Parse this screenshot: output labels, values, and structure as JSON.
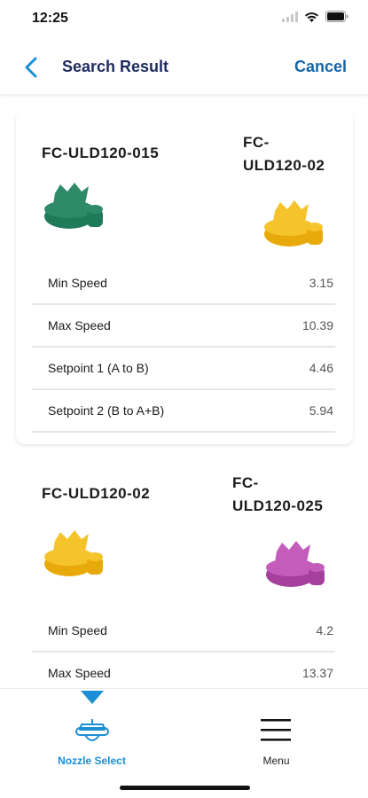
{
  "status_bar": {
    "time": "12:25"
  },
  "nav": {
    "title": "Search Result",
    "cancel_label": "Cancel"
  },
  "cards": [
    {
      "left_nozzle": {
        "name": "FC-ULD120-015",
        "color": "#1f7a5a"
      },
      "right_nozzle": {
        "name_line1": "FC-",
        "name_line2": "ULD120-02",
        "color": "#f2b511"
      },
      "specs": [
        {
          "label": "Min Speed",
          "value": "3.15"
        },
        {
          "label": "Max Speed",
          "value": "10.39"
        },
        {
          "label": "Setpoint 1 (A to B)",
          "value": "4.46"
        },
        {
          "label": "Setpoint 2 (B to A+B)",
          "value": "5.94"
        }
      ]
    },
    {
      "left_nozzle": {
        "name": "FC-ULD120-02",
        "color": "#f2b511"
      },
      "right_nozzle": {
        "name_line1": "FC-",
        "name_line2": "ULD120-025",
        "color": "#b04aa8"
      },
      "specs": [
        {
          "label": "Min Speed",
          "value": "4.2"
        },
        {
          "label": "Max Speed",
          "value": "13.37"
        }
      ]
    }
  ],
  "tabs": [
    {
      "label": "Nozzle Select",
      "icon": "nozzle-icon",
      "active": true
    },
    {
      "label": "Menu",
      "icon": "hamburger-menu-icon",
      "active": false
    }
  ],
  "colors": {
    "accent": "#1a8fd6",
    "title": "#1e2a5e",
    "cancel": "#1565a7"
  }
}
